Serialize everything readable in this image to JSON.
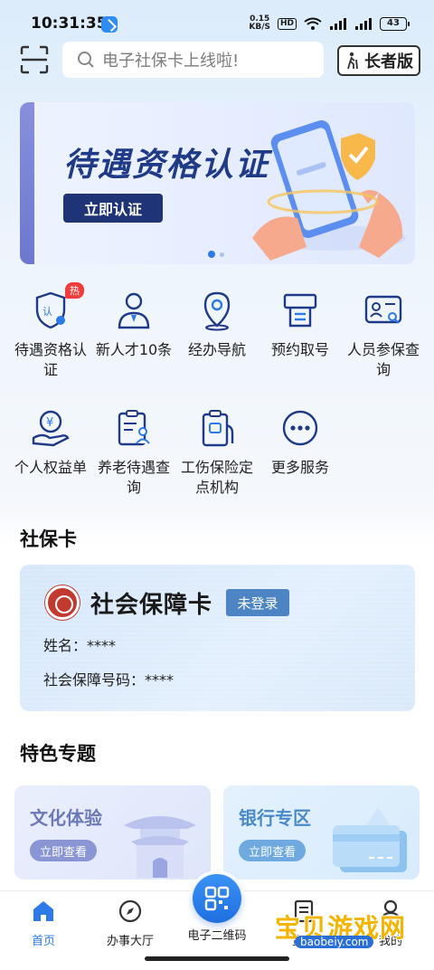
{
  "status_bar": {
    "time": "10:31:35",
    "net_speed_value": "0.15",
    "net_speed_unit": "KB/S",
    "hd_label": "HD",
    "battery": "43"
  },
  "header": {
    "search_placeholder": "电子社保卡上线啦!",
    "elder_mode_label": "长者版"
  },
  "banner": {
    "title": "待遇资格认证",
    "button_label": "立即认证",
    "slides_total": 2,
    "active_slide": 1
  },
  "services": [
    {
      "label": "待遇资格认证",
      "badge": "热",
      "icon": "shield-check-icon"
    },
    {
      "label": "新人才10条",
      "icon": "person-tie-icon"
    },
    {
      "label": "经办导航",
      "icon": "map-pin-icon"
    },
    {
      "label": "预约取号",
      "icon": "ticket-machine-icon"
    },
    {
      "label": "人员参保查询",
      "icon": "id-card-search-icon"
    },
    {
      "label": "个人权益单",
      "icon": "money-hand-icon"
    },
    {
      "label": "养老待遇查询",
      "icon": "clipboard-person-icon"
    },
    {
      "label": "工伤保险定点机构",
      "icon": "injury-insurance-icon"
    },
    {
      "label": "更多服务",
      "icon": "more-dots-icon"
    }
  ],
  "social_card": {
    "section_title": "社保卡",
    "card_title": "社会保障卡",
    "status": "未登录",
    "name_label": "姓名：",
    "name_value": "****",
    "number_label": "社会保障号码：",
    "number_value": "****"
  },
  "features": {
    "section_title": "特色专题",
    "items": [
      {
        "title": "文化体验",
        "button": "立即查看"
      },
      {
        "title": "银行专区",
        "button": "立即查看"
      }
    ]
  },
  "bottom_nav": {
    "items": [
      {
        "label": "首页",
        "icon": "home-icon",
        "active": true
      },
      {
        "label": "办事大厅",
        "icon": "compass-icon"
      },
      {
        "label": "电子二维码",
        "icon": "qr-code-icon"
      },
      {
        "label": "资讯",
        "icon": "news-icon"
      },
      {
        "label": "我的",
        "icon": "user-icon"
      }
    ]
  },
  "watermark": {
    "main": "宝贝游戏网",
    "sub": "baobeiy.com"
  },
  "colors": {
    "accent": "#2b7ae8",
    "banner_button": "#1e3476",
    "hot_badge": "#f23b3b",
    "card_status": "#4d84c3"
  }
}
